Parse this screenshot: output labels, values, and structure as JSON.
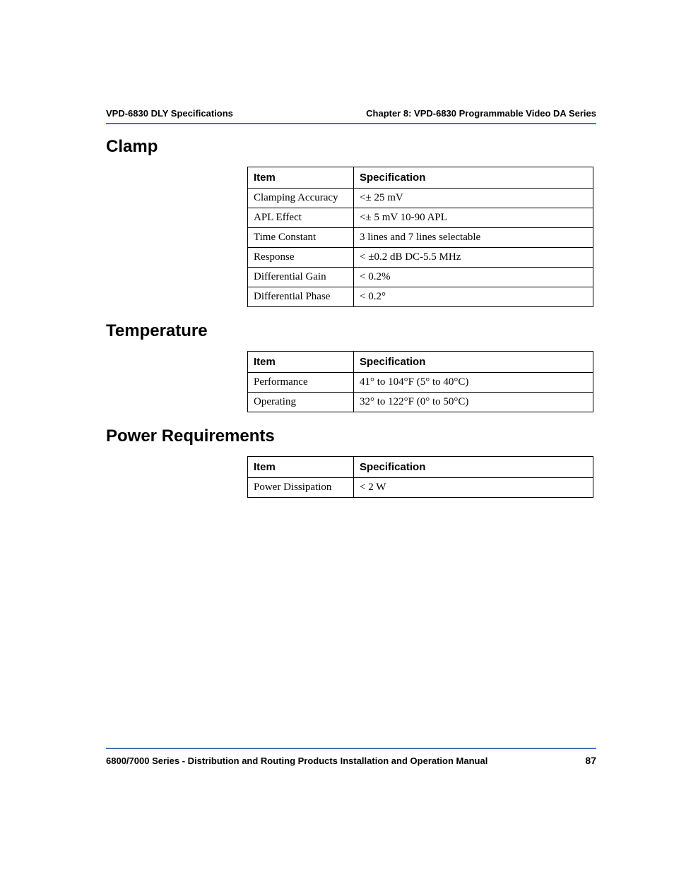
{
  "header": {
    "left": "VPD-6830 DLY Specifications",
    "right": "Chapter 8: VPD-6830 Programmable Video DA Series"
  },
  "sections": [
    {
      "heading": "Clamp",
      "col1": "Item",
      "col2": "Specification",
      "rows": [
        {
          "item": "Clamping Accuracy",
          "spec": "<± 25 mV"
        },
        {
          "item": "APL Effect",
          "spec": "<± 5 mV 10-90 APL"
        },
        {
          "item": "Time Constant",
          "spec": "3 lines and 7 lines selectable"
        },
        {
          "item": "Response",
          "spec": "< ±0.2 dB DC-5.5 MHz"
        },
        {
          "item": "Differential Gain",
          "spec": "< 0.2%"
        },
        {
          "item": "Differential Phase",
          "spec": "< 0.2°"
        }
      ]
    },
    {
      "heading": "Temperature",
      "col1": "Item",
      "col2": "Specification",
      "rows": [
        {
          "item": "Performance",
          "spec": "41° to 104°F (5° to 40°C)"
        },
        {
          "item": "Operating",
          "spec": "32° to 122°F (0° to 50°C)"
        }
      ]
    },
    {
      "heading": "Power Requirements",
      "col1": "Item",
      "col2": "Specification",
      "rows": [
        {
          "item": "Power Dissipation",
          "spec": "< 2 W"
        }
      ]
    }
  ],
  "footer": {
    "title": "6800/7000 Series - Distribution and Routing Products Installation and Operation Manual",
    "page": "87"
  }
}
